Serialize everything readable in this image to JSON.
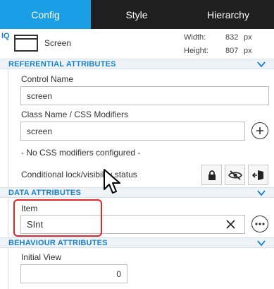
{
  "tabs": [
    {
      "label": "Config",
      "active": true
    },
    {
      "label": "Style",
      "active": false
    },
    {
      "label": "Hierarchy",
      "active": false
    }
  ],
  "screen": {
    "tag": "IQ",
    "name": "Screen",
    "width_label": "Width:",
    "width_value": "832",
    "width_unit": "px",
    "height_label": "Height:",
    "height_value": "807",
    "height_unit": "px"
  },
  "sections": {
    "referential": "REFERENTIAL ATTRIBUTES",
    "data": "DATA ATTRIBUTES",
    "behaviour": "BEHAVIOUR ATTRIBUTES"
  },
  "referential": {
    "control_name_label": "Control Name",
    "control_name_value": "screen",
    "class_name_label": "Class Name / CSS Modifiers",
    "class_name_value": "screen",
    "css_note": "- No CSS modifiers configured -",
    "conditional_label": "Conditional lock/visibility status"
  },
  "data": {
    "item_label": "Item",
    "item_value": "SInt"
  },
  "behaviour": {
    "initial_view_label": "Initial View",
    "initial_view_value": "0"
  },
  "colors": {
    "accent": "#1a9ee6",
    "tab_bar": "#1f1f1f",
    "section_text": "#1a7fc9",
    "highlight": "#e0262b"
  },
  "icons": {
    "add": "plus-circle-icon",
    "lock": "lock-icon",
    "visibility": "eye-slash-icon",
    "exit": "exit-icon",
    "clear": "close-icon",
    "more": "ellipsis-icon",
    "collapse": "chevron-down-icon"
  }
}
